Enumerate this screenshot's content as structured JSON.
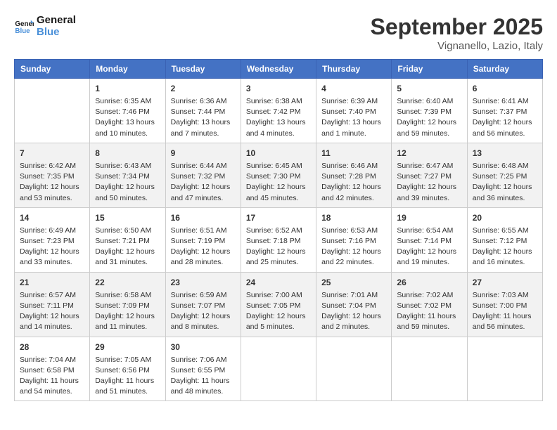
{
  "logo": {
    "line1": "General",
    "line2": "Blue"
  },
  "title": "September 2025",
  "location": "Vignanello, Lazio, Italy",
  "days_of_week": [
    "Sunday",
    "Monday",
    "Tuesday",
    "Wednesday",
    "Thursday",
    "Friday",
    "Saturday"
  ],
  "weeks": [
    [
      {
        "num": "",
        "info": ""
      },
      {
        "num": "1",
        "info": "Sunrise: 6:35 AM\nSunset: 7:46 PM\nDaylight: 13 hours\nand 10 minutes."
      },
      {
        "num": "2",
        "info": "Sunrise: 6:36 AM\nSunset: 7:44 PM\nDaylight: 13 hours\nand 7 minutes."
      },
      {
        "num": "3",
        "info": "Sunrise: 6:38 AM\nSunset: 7:42 PM\nDaylight: 13 hours\nand 4 minutes."
      },
      {
        "num": "4",
        "info": "Sunrise: 6:39 AM\nSunset: 7:40 PM\nDaylight: 13 hours\nand 1 minute."
      },
      {
        "num": "5",
        "info": "Sunrise: 6:40 AM\nSunset: 7:39 PM\nDaylight: 12 hours\nand 59 minutes."
      },
      {
        "num": "6",
        "info": "Sunrise: 6:41 AM\nSunset: 7:37 PM\nDaylight: 12 hours\nand 56 minutes."
      }
    ],
    [
      {
        "num": "7",
        "info": "Sunrise: 6:42 AM\nSunset: 7:35 PM\nDaylight: 12 hours\nand 53 minutes."
      },
      {
        "num": "8",
        "info": "Sunrise: 6:43 AM\nSunset: 7:34 PM\nDaylight: 12 hours\nand 50 minutes."
      },
      {
        "num": "9",
        "info": "Sunrise: 6:44 AM\nSunset: 7:32 PM\nDaylight: 12 hours\nand 47 minutes."
      },
      {
        "num": "10",
        "info": "Sunrise: 6:45 AM\nSunset: 7:30 PM\nDaylight: 12 hours\nand 45 minutes."
      },
      {
        "num": "11",
        "info": "Sunrise: 6:46 AM\nSunset: 7:28 PM\nDaylight: 12 hours\nand 42 minutes."
      },
      {
        "num": "12",
        "info": "Sunrise: 6:47 AM\nSunset: 7:27 PM\nDaylight: 12 hours\nand 39 minutes."
      },
      {
        "num": "13",
        "info": "Sunrise: 6:48 AM\nSunset: 7:25 PM\nDaylight: 12 hours\nand 36 minutes."
      }
    ],
    [
      {
        "num": "14",
        "info": "Sunrise: 6:49 AM\nSunset: 7:23 PM\nDaylight: 12 hours\nand 33 minutes."
      },
      {
        "num": "15",
        "info": "Sunrise: 6:50 AM\nSunset: 7:21 PM\nDaylight: 12 hours\nand 31 minutes."
      },
      {
        "num": "16",
        "info": "Sunrise: 6:51 AM\nSunset: 7:19 PM\nDaylight: 12 hours\nand 28 minutes."
      },
      {
        "num": "17",
        "info": "Sunrise: 6:52 AM\nSunset: 7:18 PM\nDaylight: 12 hours\nand 25 minutes."
      },
      {
        "num": "18",
        "info": "Sunrise: 6:53 AM\nSunset: 7:16 PM\nDaylight: 12 hours\nand 22 minutes."
      },
      {
        "num": "19",
        "info": "Sunrise: 6:54 AM\nSunset: 7:14 PM\nDaylight: 12 hours\nand 19 minutes."
      },
      {
        "num": "20",
        "info": "Sunrise: 6:55 AM\nSunset: 7:12 PM\nDaylight: 12 hours\nand 16 minutes."
      }
    ],
    [
      {
        "num": "21",
        "info": "Sunrise: 6:57 AM\nSunset: 7:11 PM\nDaylight: 12 hours\nand 14 minutes."
      },
      {
        "num": "22",
        "info": "Sunrise: 6:58 AM\nSunset: 7:09 PM\nDaylight: 12 hours\nand 11 minutes."
      },
      {
        "num": "23",
        "info": "Sunrise: 6:59 AM\nSunset: 7:07 PM\nDaylight: 12 hours\nand 8 minutes."
      },
      {
        "num": "24",
        "info": "Sunrise: 7:00 AM\nSunset: 7:05 PM\nDaylight: 12 hours\nand 5 minutes."
      },
      {
        "num": "25",
        "info": "Sunrise: 7:01 AM\nSunset: 7:04 PM\nDaylight: 12 hours\nand 2 minutes."
      },
      {
        "num": "26",
        "info": "Sunrise: 7:02 AM\nSunset: 7:02 PM\nDaylight: 11 hours\nand 59 minutes."
      },
      {
        "num": "27",
        "info": "Sunrise: 7:03 AM\nSunset: 7:00 PM\nDaylight: 11 hours\nand 56 minutes."
      }
    ],
    [
      {
        "num": "28",
        "info": "Sunrise: 7:04 AM\nSunset: 6:58 PM\nDaylight: 11 hours\nand 54 minutes."
      },
      {
        "num": "29",
        "info": "Sunrise: 7:05 AM\nSunset: 6:56 PM\nDaylight: 11 hours\nand 51 minutes."
      },
      {
        "num": "30",
        "info": "Sunrise: 7:06 AM\nSunset: 6:55 PM\nDaylight: 11 hours\nand 48 minutes."
      },
      {
        "num": "",
        "info": ""
      },
      {
        "num": "",
        "info": ""
      },
      {
        "num": "",
        "info": ""
      },
      {
        "num": "",
        "info": ""
      }
    ]
  ]
}
